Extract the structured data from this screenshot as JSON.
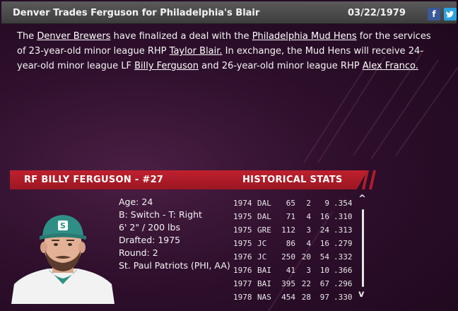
{
  "header": {
    "title": "Denver Trades Ferguson for Philadelphia's Blair",
    "date": "03/22/1979",
    "facebook_glyph": "f",
    "twitter_glyph": "t"
  },
  "article": {
    "p1": "The ",
    "link_team1": "Denver Brewers",
    "p2": " have finalized a deal with the ",
    "link_team2": "Philadelphia Mud Hens",
    "p3": " for the services of 23-year-old  minor league RHP ",
    "link_player1": "Taylor Blair.",
    "p4": " In exchange, the Mud Hens will receive 24-year-old minor league LF ",
    "link_player2": "Billy Ferguson",
    "p5": " and 26-year-old  minor league RHP ",
    "link_player3": "Alex Franco."
  },
  "player": {
    "name_label": "RF BILLY FERGUSON - #27",
    "age": "Age: 24",
    "bats_throws": "B: Switch - T: Right",
    "height_weight": "6' 2\" / 200 lbs",
    "drafted": "Drafted: 1975",
    "round": "Round: 2",
    "team": "St. Paul Patriots (PHI, AA)",
    "cap_letter": "S",
    "cap_color": "#2f8f86"
  },
  "stats": {
    "title": "HISTORICAL STATS",
    "scroll_up": "^",
    "scroll_down": "v",
    "rows": [
      {
        "year": "1974",
        "team": "DAL",
        "ab": "65",
        "hr": "2",
        "rbi": "9",
        "avg": ".354"
      },
      {
        "year": "1975",
        "team": "DAL",
        "ab": "71",
        "hr": "4",
        "rbi": "16",
        "avg": ".310"
      },
      {
        "year": "1975",
        "team": "GRE",
        "ab": "112",
        "hr": "3",
        "rbi": "24",
        "avg": ".313"
      },
      {
        "year": "1975",
        "team": "JC",
        "ab": "86",
        "hr": "4",
        "rbi": "16",
        "avg": ".279"
      },
      {
        "year": "1976",
        "team": "JC",
        "ab": "250",
        "hr": "20",
        "rbi": "54",
        "avg": ".332"
      },
      {
        "year": "1976",
        "team": "BAI",
        "ab": "41",
        "hr": "3",
        "rbi": "10",
        "avg": ".366"
      },
      {
        "year": "1977",
        "team": "BAI",
        "ab": "395",
        "hr": "22",
        "rbi": "67",
        "avg": ".296"
      },
      {
        "year": "1978",
        "team": "NAS",
        "ab": "454",
        "hr": "28",
        "rbi": "97",
        "avg": ".330"
      }
    ]
  },
  "colors": {
    "accent": "#b01d2a",
    "background": "#2e0f2c"
  }
}
